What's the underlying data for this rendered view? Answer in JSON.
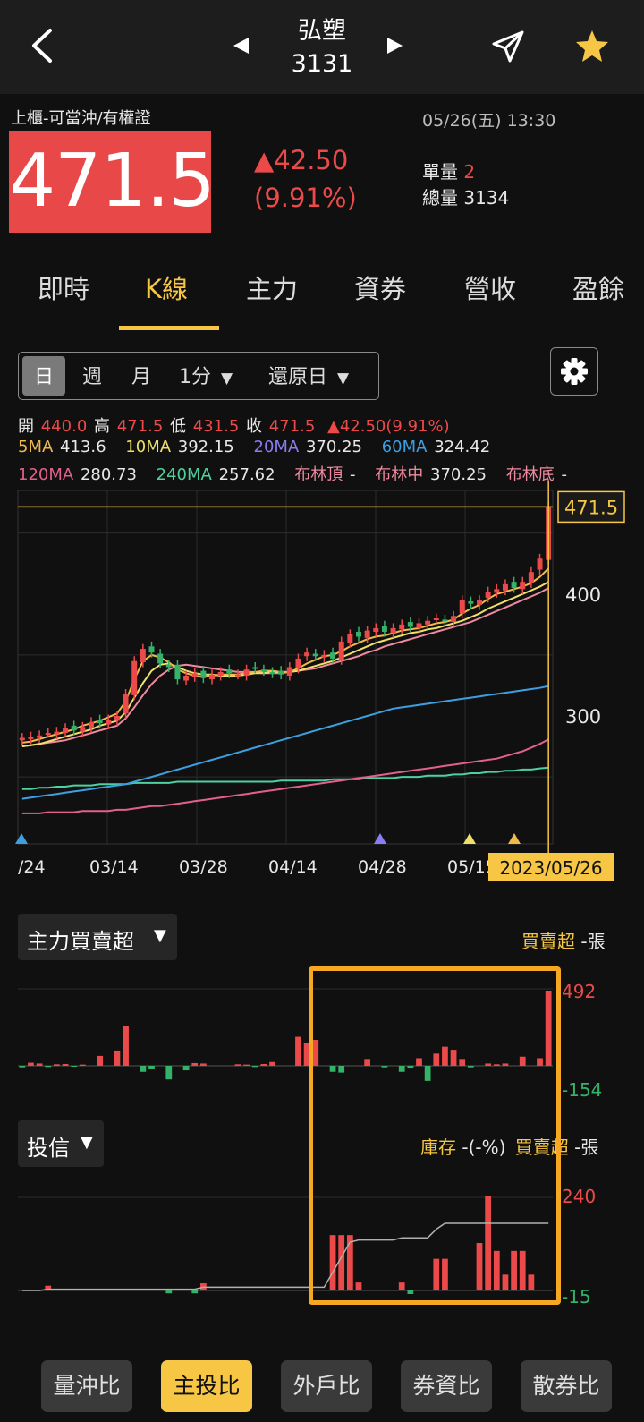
{
  "header": {
    "stock_name": "弘塑",
    "stock_code": "3131",
    "back_icon": "chevron-left-icon",
    "prev_icon": "triangle-left-icon",
    "next_icon": "triangle-right-icon",
    "share_icon": "paper-plane-icon",
    "favorite_icon": "star-icon"
  },
  "quote": {
    "market_tag": "上櫃-可當沖/有權證",
    "datetime": "05/26(五) 13:30",
    "price": "471.5",
    "change": "▲42.50",
    "change_pct": "(9.91%)",
    "unit_vol_label": "單量",
    "unit_vol_value": "2",
    "total_vol_label": "總量",
    "total_vol_value": "3134"
  },
  "tabs": [
    "即時",
    "K線",
    "主力",
    "資券",
    "營收",
    "盈餘"
  ],
  "active_tab": "K線",
  "period_selector": {
    "day": "日",
    "week": "週",
    "month": "月",
    "minute": "1分",
    "restore": "還原日",
    "selected": "日"
  },
  "ohlc": {
    "open_label": "開",
    "open": "440.0",
    "high_label": "高",
    "high": "471.5",
    "low_label": "低",
    "low": "431.5",
    "close_label": "收",
    "close": "471.5",
    "change": "▲42.50(9.91%)"
  },
  "ma": {
    "ma5_label": "5MA",
    "ma5": "413.6",
    "ma10_label": "10MA",
    "ma10": "392.15",
    "ma20_label": "20MA",
    "ma20": "370.25",
    "ma60_label": "60MA",
    "ma60": "324.42",
    "ma120_label": "120MA",
    "ma120": "280.73",
    "ma240_label": "240MA",
    "ma240": "257.62",
    "boll_top_label": "布林頂",
    "boll_top": "-",
    "boll_mid_label": "布林中",
    "boll_mid": "370.25",
    "boll_bot_label": "布林底",
    "boll_bot": "-"
  },
  "colors": {
    "up": "#ec4a4a",
    "down": "#34b26a",
    "accent": "#f6c644",
    "ma5": "#f0b94a",
    "ma10": "#efe06a",
    "ma20": "#8a7cf2",
    "ma60": "#3d9fe0",
    "ma120": "#e2608e",
    "ma240": "#4fd0a0",
    "boll": "#f08aa0"
  },
  "chart_data": [
    {
      "type": "candlestick",
      "title": "",
      "x_ticks": [
        "/24",
        "03/14",
        "03/28",
        "04/14",
        "04/28",
        "05/15"
      ],
      "y_ticks": [
        300,
        400
      ],
      "last_price_label": "471.5",
      "crosshair_date": "2023/05/26",
      "ylim": [
        195,
        485
      ],
      "closes": [
        282,
        283,
        284,
        286,
        287,
        290,
        288,
        291,
        295,
        294,
        297,
        300,
        318,
        345,
        355,
        352,
        343,
        340,
        330,
        333,
        335,
        331,
        334,
        336,
        335,
        334,
        338,
        339,
        337,
        335,
        334,
        340,
        347,
        352,
        349,
        350,
        347,
        361,
        367,
        365,
        370,
        372,
        369,
        372,
        375,
        373,
        376,
        378,
        380,
        378,
        382,
        395,
        392,
        395,
        402,
        404,
        408,
        405,
        410,
        418,
        429,
        471.5
      ],
      "ma5": [
        278,
        279,
        281,
        283,
        285,
        287,
        289,
        292,
        294,
        296,
        299,
        302,
        312,
        330,
        345,
        350,
        348,
        344,
        338,
        335,
        333,
        332,
        333,
        334,
        334,
        334,
        335,
        336,
        337,
        337,
        336,
        336,
        339,
        343,
        346,
        349,
        350,
        353,
        357,
        360,
        363,
        365,
        366,
        368,
        370,
        371,
        372,
        374,
        376,
        377,
        379,
        384,
        388,
        391,
        396,
        400,
        402,
        404,
        406,
        409,
        414,
        421
      ],
      "ma10": [
        275,
        276,
        277,
        279,
        281,
        283,
        285,
        287,
        289,
        292,
        294,
        296,
        303,
        315,
        327,
        337,
        342,
        343,
        340,
        337,
        335,
        334,
        334,
        333,
        333,
        333,
        334,
        335,
        335,
        336,
        336,
        336,
        337,
        339,
        341,
        343,
        345,
        348,
        351,
        354,
        357,
        360,
        362,
        364,
        366,
        368,
        369,
        371,
        372,
        374,
        376,
        378,
        381,
        384,
        388,
        391,
        394,
        397,
        400,
        403,
        406,
        410
      ],
      "bollinger_mid": [
        275,
        276,
        277,
        278,
        279,
        280,
        282,
        284,
        286,
        288,
        290,
        292,
        298,
        307,
        317,
        326,
        333,
        338,
        341,
        342,
        341,
        340,
        339,
        338,
        337,
        336,
        336,
        336,
        335,
        335,
        335,
        336,
        337,
        338,
        339,
        341,
        343,
        345,
        347,
        349,
        352,
        354,
        357,
        359,
        361,
        363,
        365,
        367,
        369,
        371,
        373,
        375,
        377,
        380,
        383,
        386,
        389,
        392,
        395,
        398,
        401,
        405
      ],
      "ma60": [
        232,
        233,
        234,
        235,
        236,
        237,
        238,
        239,
        240,
        241,
        242,
        243,
        244,
        246,
        248,
        250,
        252,
        254,
        256,
        258,
        260,
        262,
        264,
        266,
        268,
        270,
        272,
        274,
        276,
        278,
        280,
        282,
        284,
        286,
        288,
        290,
        292,
        294,
        296,
        298,
        300,
        302,
        304,
        306,
        307,
        308,
        309,
        310,
        311,
        312,
        313,
        314,
        315,
        316,
        317,
        318,
        319,
        320,
        321,
        322,
        323,
        324.42
      ],
      "ma120": [
        220,
        220,
        220,
        221,
        221,
        221,
        221,
        222,
        222,
        222,
        222,
        223,
        223,
        224,
        225,
        226,
        226,
        227,
        228,
        229,
        230,
        231,
        232,
        233,
        234,
        235,
        236,
        237,
        238,
        239,
        240,
        241,
        242,
        243,
        244,
        245,
        246,
        247,
        248,
        249,
        250,
        251,
        252,
        253,
        254,
        255,
        256,
        257,
        258,
        259,
        260,
        261,
        262,
        263,
        264,
        265,
        267,
        269,
        271,
        274,
        277,
        280.73
      ],
      "ma240": [
        240,
        240,
        241,
        241,
        242,
        242,
        243,
        243,
        243,
        244,
        244,
        244,
        244,
        245,
        245,
        245,
        245,
        245,
        246,
        246,
        246,
        246,
        246,
        246,
        246,
        246,
        246,
        246,
        246,
        246,
        247,
        247,
        247,
        247,
        247,
        247,
        248,
        248,
        248,
        248,
        249,
        249,
        249,
        249,
        250,
        250,
        250,
        251,
        251,
        251,
        252,
        252,
        253,
        253,
        254,
        254,
        255,
        255,
        256,
        256,
        257,
        257.62
      ],
      "series": [
        {
          "name": "5MA",
          "color": "#f0b94a"
        },
        {
          "name": "10MA",
          "color": "#efe06a"
        },
        {
          "name": "20MA",
          "color": "#8a7cf2"
        },
        {
          "name": "60MA",
          "color": "#3d9fe0"
        },
        {
          "name": "120MA",
          "color": "#e2608e"
        },
        {
          "name": "240MA",
          "color": "#4fd0a0"
        },
        {
          "name": "布林中",
          "color": "#f08aa0"
        }
      ]
    },
    {
      "type": "bar",
      "title": "主力買賣超",
      "unit_label": "買賣超",
      "unit_value": "-張",
      "ylim": [
        -154,
        492
      ],
      "y_ticks": [
        "492",
        "-154"
      ],
      "values": [
        -10,
        20,
        15,
        -8,
        10,
        12,
        -5,
        8,
        0,
        65,
        0,
        100,
        260,
        0,
        -40,
        -20,
        0,
        -90,
        0,
        -30,
        18,
        15,
        0,
        0,
        0,
        10,
        8,
        -8,
        12,
        25,
        0,
        0,
        190,
        150,
        170,
        0,
        -40,
        -45,
        0,
        0,
        45,
        0,
        -10,
        0,
        -40,
        -12,
        50,
        -100,
        80,
        125,
        105,
        45,
        -10,
        0,
        15,
        10,
        15,
        0,
        60,
        0,
        50,
        492
      ]
    },
    {
      "type": "bar",
      "title": "投信",
      "unit_label": "庫存",
      "unit_value": "-(-%)",
      "unit_label2": "買賣超",
      "unit_value2": "-張",
      "ylim": [
        -15,
        240
      ],
      "y_ticks": [
        "240",
        "-15"
      ],
      "values": [
        0,
        0,
        0,
        0,
        0,
        0,
        0,
        0,
        0,
        0,
        0,
        0,
        0,
        0,
        0,
        0,
        0,
        0,
        0,
        0,
        0,
        0,
        0,
        0,
        0,
        0,
        0,
        0,
        0,
        0,
        0,
        0,
        0,
        0,
        0,
        0,
        0,
        0,
        0,
        0,
        0,
        0,
        0,
        0,
        0,
        0,
        0,
        0,
        0,
        0,
        0,
        0,
        0,
        0,
        0,
        0,
        0,
        0,
        0,
        0,
        0,
        0
      ],
      "sparse_values": [
        [
          3,
          12
        ],
        [
          17,
          -8
        ],
        [
          20,
          -8
        ],
        [
          21,
          18
        ],
        [
          36,
          140
        ],
        [
          37,
          140
        ],
        [
          38,
          140
        ],
        [
          39,
          20
        ],
        [
          44,
          20
        ],
        [
          45,
          -10
        ],
        [
          48,
          80
        ],
        [
          49,
          80
        ],
        [
          53,
          120
        ],
        [
          54,
          240
        ],
        [
          55,
          100
        ],
        [
          56,
          40
        ],
        [
          57,
          100
        ],
        [
          58,
          100
        ],
        [
          59,
          40
        ]
      ],
      "inventory_line": [
        0,
        0,
        0,
        0,
        0,
        0,
        0,
        0,
        0,
        0,
        0,
        0,
        0,
        0,
        0,
        0,
        0,
        0,
        0,
        0,
        0,
        0,
        0,
        0,
        0,
        0,
        0,
        0,
        0,
        0,
        0,
        0,
        0,
        0,
        0,
        0,
        0,
        0,
        0,
        0,
        0,
        0,
        0,
        0,
        0,
        0,
        0,
        0,
        0,
        0,
        0,
        0,
        0,
        0,
        0,
        0,
        0,
        0,
        0,
        0,
        0,
        0
      ]
    }
  ],
  "bottom_buttons": [
    "量沖比",
    "主投比",
    "外戶比",
    "券資比",
    "散券比"
  ],
  "active_button": "主投比"
}
